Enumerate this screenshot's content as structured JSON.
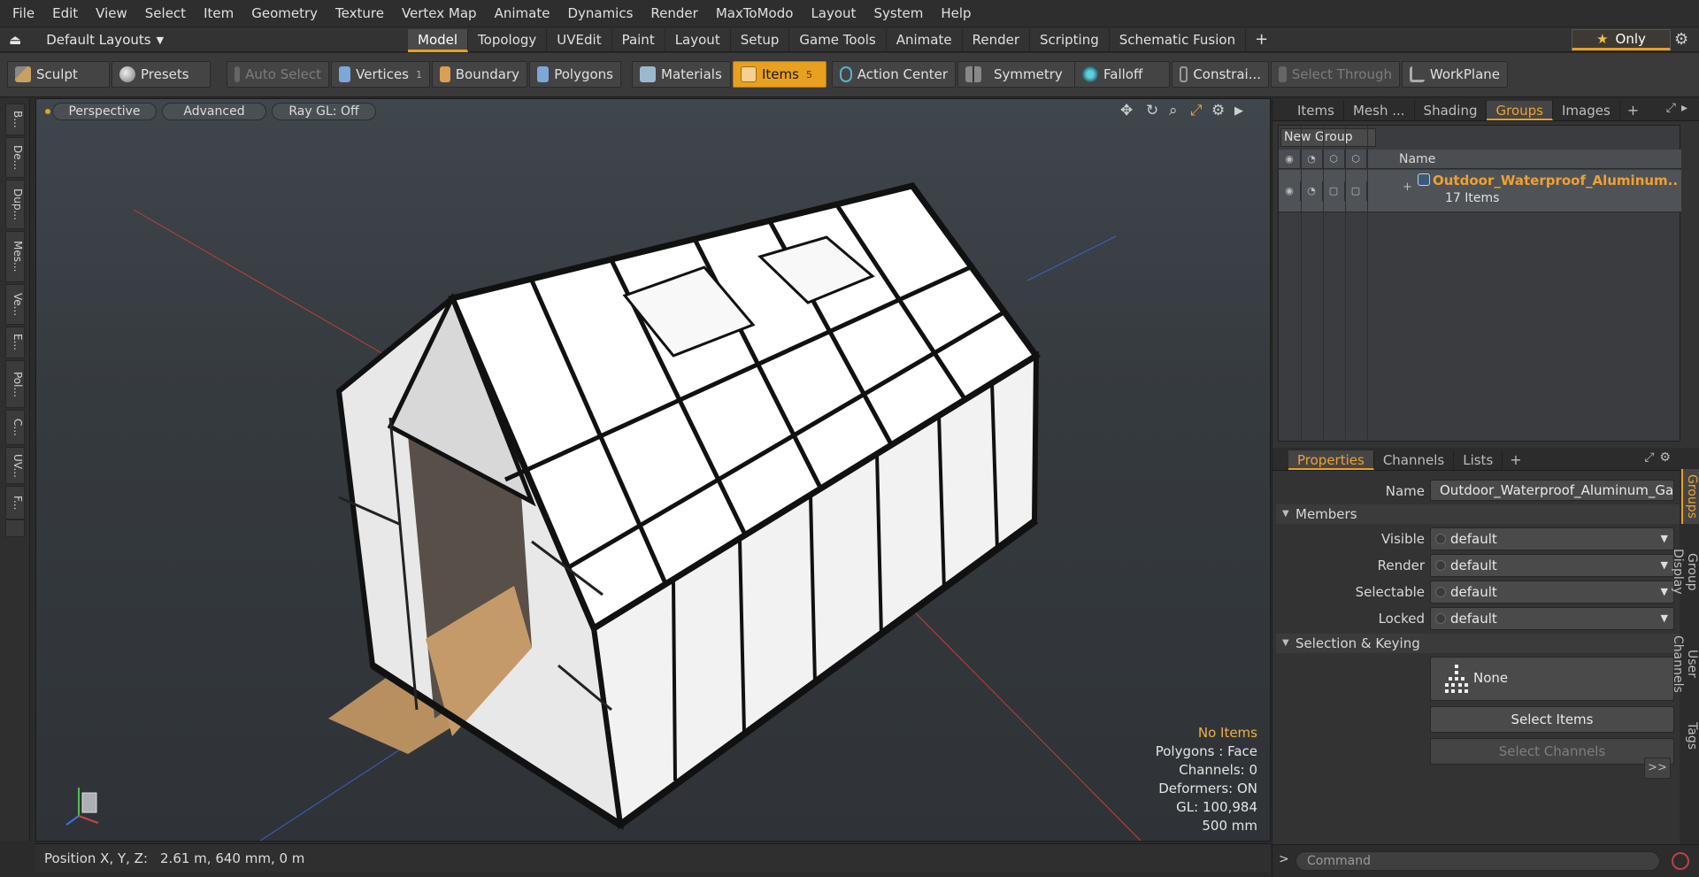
{
  "menubar": {
    "items": [
      "File",
      "Edit",
      "View",
      "Select",
      "Item",
      "Geometry",
      "Texture",
      "Vertex Map",
      "Animate",
      "Dynamics",
      "Render",
      "MaxToModo",
      "Layout",
      "System",
      "Help"
    ]
  },
  "layoutbar": {
    "layout_label": "Default Layouts",
    "tabs": [
      "Model",
      "Topology",
      "UVEdit",
      "Paint",
      "Layout",
      "Setup",
      "Game Tools",
      "Animate",
      "Render",
      "Scripting",
      "Schematic Fusion"
    ],
    "active_tab": "Model",
    "only_label": "Only"
  },
  "toolbar": {
    "sculpt": "Sculpt",
    "presets": "Presets",
    "auto_select": "Auto Select",
    "vertices": "Vertices",
    "vertices_count": "1",
    "boundary": "Boundary",
    "polygons": "Polygons",
    "materials": "Materials",
    "items": "Items",
    "items_count": "5",
    "action_center": "Action Center",
    "symmetry": "Symmetry",
    "falloff": "Falloff",
    "constraints": "Constrai...",
    "select_through": "Select Through",
    "workplane": "WorkPlane"
  },
  "left_strip": [
    "B...",
    "De...",
    "Dup...",
    "Mes...",
    "Ve...",
    "E...",
    "Pol...",
    "C...",
    "UV...",
    "F..."
  ],
  "viewport": {
    "view_mode": "Perspective",
    "shading": "Advanced",
    "raygl": "Ray GL: Off",
    "info": {
      "no_items": "No Items",
      "polygons": "Polygons : Face",
      "channels": "Channels: 0",
      "deformers": "Deformers: ON",
      "gl": "GL: 100,984",
      "scale": "500 mm"
    }
  },
  "statusbar": {
    "label": "Position X, Y, Z:",
    "value": "2.61 m, 640 mm, 0 m"
  },
  "groups_panel": {
    "tabs": [
      "Items",
      "Mesh ...",
      "Shading",
      "Groups",
      "Images"
    ],
    "active_tab": "Groups",
    "new_group": "New Group",
    "column_name": "Name",
    "group": {
      "name": "Outdoor_Waterproof_Aluminum...",
      "count": "17 Items"
    }
  },
  "properties_panel": {
    "tabs": [
      "Properties",
      "Channels",
      "Lists"
    ],
    "active_tab": "Properties",
    "name_label": "Name",
    "name_value": "Outdoor_Waterproof_Aluminum_Gaze",
    "members_section": "Members",
    "visible_label": "Visible",
    "visible_value": "default",
    "render_label": "Render",
    "render_value": "default",
    "selectable_label": "Selectable",
    "selectable_value": "default",
    "locked_label": "Locked",
    "locked_value": "default",
    "selection_section": "Selection & Keying",
    "none_label": "None",
    "select_items": "Select Items",
    "select_channels": "Select Channels",
    "more": ">>",
    "side_tabs": [
      "Groups",
      "Group Display",
      "User Channels",
      "Tags"
    ]
  },
  "command": {
    "prompt": ">",
    "placeholder": "Command"
  },
  "colors": {
    "accent": "#e8a020",
    "group_name": "#f0a030"
  }
}
